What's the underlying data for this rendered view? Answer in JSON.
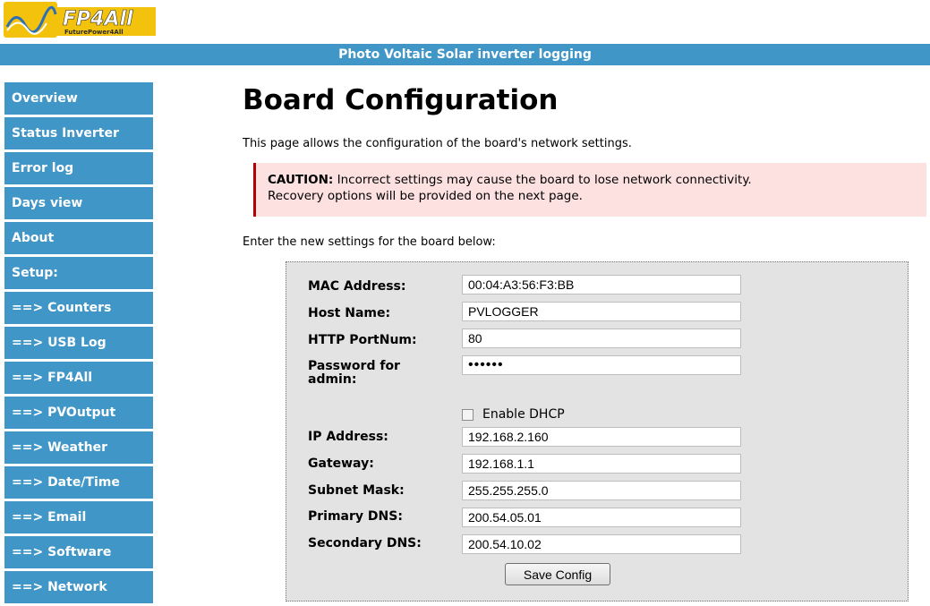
{
  "logo": {
    "text": "FP4All",
    "tagline": "FuturePower4All"
  },
  "header": {
    "title": "Photo Voltaic Solar inverter logging"
  },
  "sidebar": {
    "items": [
      {
        "label": "Overview"
      },
      {
        "label": "Status Inverter"
      },
      {
        "label": "Error log"
      },
      {
        "label": "Days view"
      },
      {
        "label": "About"
      },
      {
        "label": "Setup:"
      },
      {
        "label": "==> Counters"
      },
      {
        "label": "==> USB Log"
      },
      {
        "label": "==> FP4All"
      },
      {
        "label": "==> PVOutput"
      },
      {
        "label": "==> Weather"
      },
      {
        "label": "==> Date/Time"
      },
      {
        "label": "==> Email"
      },
      {
        "label": "==> Software"
      },
      {
        "label": "==> Network"
      }
    ]
  },
  "main": {
    "title": "Board Configuration",
    "intro": "This page allows the configuration of the board's network settings.",
    "caution": {
      "prefix": "CAUTION:",
      "line1": " Incorrect settings may cause the board to lose network connectivity.",
      "line2": "Recovery options will be provided on the next page."
    },
    "enter_text": "Enter the new settings for the board below:"
  },
  "form": {
    "mac": {
      "label": "MAC Address:",
      "value": "00:04:A3:56:F3:BB"
    },
    "host": {
      "label": "Host Name:",
      "value": "PVLOGGER"
    },
    "port": {
      "label": "HTTP PortNum:",
      "value": "80"
    },
    "password": {
      "label": "Password for admin:",
      "value": "••••••"
    },
    "dhcp": {
      "label": "Enable DHCP",
      "checked": false
    },
    "ip": {
      "label": "IP Address:",
      "value": "192.168.2.160"
    },
    "gateway": {
      "label": "Gateway:",
      "value": "192.168.1.1"
    },
    "subnet": {
      "label": "Subnet Mask:",
      "value": "255.255.255.0"
    },
    "dns1": {
      "label": "Primary DNS:",
      "value": "200.54.05.01"
    },
    "dns2": {
      "label": "Secondary DNS:",
      "value": "200.54.10.02"
    },
    "save_label": "Save Config"
  },
  "colors": {
    "nav_bg": "#4196c8",
    "caution_bg": "#fde0e0",
    "caution_border": "#b30000",
    "panel_bg": "#e3e3e3"
  }
}
